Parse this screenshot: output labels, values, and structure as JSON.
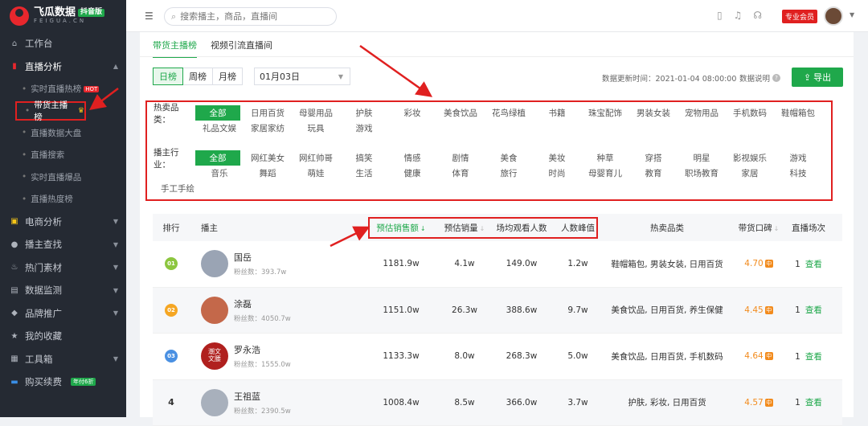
{
  "sidebar": {
    "logo_title": "飞瓜数据",
    "logo_badge": "抖音版",
    "logo_sub": "FEIGUA.CN",
    "items": [
      {
        "label": "工作台",
        "icon": "home-icon"
      },
      {
        "label": "直播分析",
        "icon": "bar-chart-icon"
      },
      {
        "label": "电商分析",
        "icon": "bag-icon"
      },
      {
        "label": "播主查找",
        "icon": "search-icon"
      },
      {
        "label": "热门素材",
        "icon": "fire-icon"
      },
      {
        "label": "数据监测",
        "icon": "monitor-icon"
      },
      {
        "label": "品牌推广",
        "icon": "megaphone-icon"
      },
      {
        "label": "我的收藏",
        "icon": "star-icon"
      },
      {
        "label": "工具箱",
        "icon": "toolbox-icon"
      },
      {
        "label": "购买续费",
        "icon": "card-icon"
      }
    ],
    "renew_badge": "年付6折",
    "live_sub": [
      {
        "label": "实时直播热榜",
        "badge": "HOT"
      },
      {
        "label": "带货主播榜"
      },
      {
        "label": "直播数据大盘"
      },
      {
        "label": "直播搜索"
      },
      {
        "label": "实时直播爆品"
      },
      {
        "label": "直播热度榜"
      }
    ]
  },
  "topbar": {
    "search_placeholder": "搜索播主，商品，直播间",
    "vip_label": "专业会员"
  },
  "tabs": [
    "带货主播榜",
    "视频引流直播间"
  ],
  "period": [
    "日榜",
    "周榜",
    "月榜"
  ],
  "date_value": "01月03日",
  "update_time": "数据更新时间：2021-01-04 08:00:00",
  "explain_label": "数据说明",
  "export_label": "导出",
  "filters": {
    "category_label": "热卖品类：",
    "categories": [
      "全部",
      "日用百货",
      "母婴用品",
      "护肤",
      "彩妆",
      "美食饮品",
      "花鸟绿植",
      "书籍",
      "珠宝配饰",
      "男装女装",
      "宠物用品",
      "手机数码",
      "鞋帽箱包",
      "礼品文娱",
      "家居家纺",
      "玩具",
      "游戏"
    ],
    "industry_label": "播主行业：",
    "industries": [
      "全部",
      "网红美女",
      "网红帅哥",
      "搞笑",
      "情感",
      "剧情",
      "美食",
      "美妆",
      "种草",
      "穿搭",
      "明星",
      "影视娱乐",
      "游戏",
      "音乐",
      "舞蹈",
      "萌娃",
      "生活",
      "健康",
      "体育",
      "旅行",
      "时尚",
      "母婴育儿",
      "教育",
      "职场教育",
      "家居",
      "科技",
      "手工手绘"
    ]
  },
  "table": {
    "headers": {
      "rank": "排行",
      "anchor": "播主",
      "sales": "预估销售额",
      "volume": "预估销量",
      "viewers": "场均观看人数",
      "peak": "人数峰值",
      "categories": "热卖品类",
      "reputation": "带货口碑",
      "sessions": "直播场次"
    },
    "fans_prefix": "粉丝数：",
    "view_label": "查看",
    "rows": [
      {
        "rank": "01",
        "name": "国岳",
        "fans": "393.7w",
        "sales": "1181.9w",
        "volume": "4.1w",
        "viewers": "149.0w",
        "peak": "1.2w",
        "cats": "鞋帽箱包, 男装女装, 日用百货",
        "rep": "4.70",
        "sessions": "1"
      },
      {
        "rank": "02",
        "name": "涂磊",
        "fans": "4050.7w",
        "sales": "1151.0w",
        "volume": "26.3w",
        "viewers": "388.6w",
        "peak": "9.7w",
        "cats": "美食饮品, 日用百货, 养生保健",
        "rep": "4.45",
        "sessions": "1"
      },
      {
        "rank": "03",
        "name": "罗永浩",
        "fans": "1555.0w",
        "sales": "1133.3w",
        "volume": "8.0w",
        "viewers": "268.3w",
        "peak": "5.0w",
        "cats": "美食饮品, 日用百货, 手机数码",
        "rep": "4.64",
        "sessions": "1",
        "avatar_text": "潮文\n文腰"
      },
      {
        "rank": "4",
        "name": "王祖蓝",
        "fans": "2390.5w",
        "sales": "1008.4w",
        "volume": "8.5w",
        "viewers": "366.0w",
        "peak": "3.7w",
        "cats": "护肤, 彩妆, 日用百货",
        "rep": "4.57",
        "sessions": "1"
      }
    ],
    "rep_badge": "中"
  },
  "colors": {
    "accent": "#1fa84b",
    "highlight": "#e02020",
    "sidebar": "#252a33",
    "rating": "#f28b1d"
  }
}
